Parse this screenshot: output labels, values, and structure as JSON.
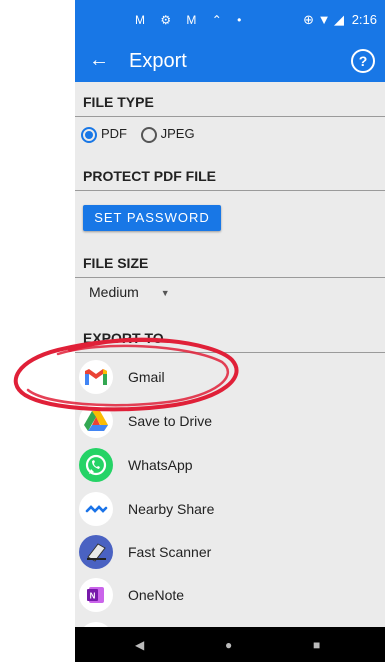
{
  "status": {
    "left_icons": "M ⚙ M ⌃ •",
    "right_icons": "⊕ ▼ ◢",
    "time": "2:16"
  },
  "appbar": {
    "title": "Export",
    "help": "?"
  },
  "file_type": {
    "title": "FILE TYPE",
    "options": [
      "PDF",
      "JPEG"
    ],
    "selected": "PDF"
  },
  "protect": {
    "title": "PROTECT PDF FILE",
    "button": "SET PASSWORD"
  },
  "file_size": {
    "title": "FILE SIZE",
    "value": "Medium"
  },
  "export_to": {
    "title": "EXPORT TO",
    "items": [
      {
        "label": "Gmail",
        "icon": "gmail-icon"
      },
      {
        "label": "Save to Drive",
        "icon": "drive-icon"
      },
      {
        "label": "WhatsApp",
        "icon": "whatsapp-icon"
      },
      {
        "label": "Nearby Share",
        "icon": "nearby-share-icon"
      },
      {
        "label": "Fast Scanner",
        "icon": "fast-scanner-icon"
      },
      {
        "label": "OneNote",
        "icon": "onenote-icon"
      }
    ]
  },
  "colors": {
    "accent": "#1877e6",
    "annotation": "#e02038"
  }
}
